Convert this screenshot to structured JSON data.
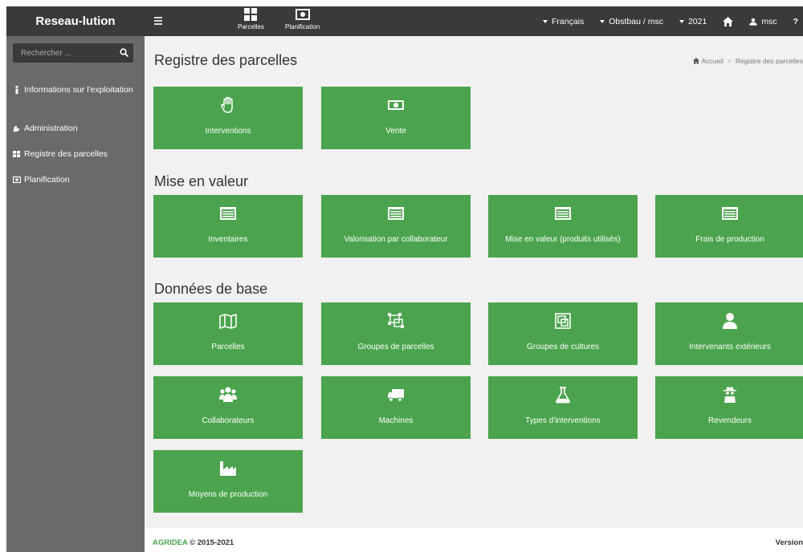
{
  "app": {
    "brand": "Reseau-lution"
  },
  "topnav": {
    "parcelles": "Parcelles",
    "planification": "Planification",
    "language": "Français",
    "account": "Obstbau / msc",
    "year": "2021",
    "user": "msc",
    "help": "?"
  },
  "sidebar": {
    "search_placeholder": "Rechercher ...",
    "items": [
      {
        "label": "Informations sur l'exploitation",
        "icon": "info-icon"
      },
      {
        "label": "Administration",
        "icon": "wrench-icon"
      },
      {
        "label": "Registre des parcelles",
        "icon": "grid-icon"
      },
      {
        "label": "Planification",
        "icon": "money-icon"
      }
    ]
  },
  "page": {
    "title": "Registre des parcelles",
    "breadcrumb": {
      "home": "Accueil",
      "separator": ">",
      "current": "Registre des parcelles"
    }
  },
  "sections": {
    "mise_en_valeur": "Mise en valeur",
    "donnees_de_base": "Données de base"
  },
  "tiles": {
    "interventions": "Interventions",
    "vente": "Vente",
    "inventaires": "Inventaires",
    "valorisation": "Valorisation par collaborateur",
    "mise_en_valeur_produits": "Mise en valeur (produits utilisés)",
    "frais": "Frais de production",
    "parcelles": "Parcelles",
    "groupes_parcelles": "Groupes de parcelles",
    "groupes_cultures": "Groupes de cultures",
    "intervenants": "Intervenants extérieurs",
    "collaborateurs": "Collaborateurs",
    "machines": "Machines",
    "types_interventions": "Types d'interventions",
    "revendeurs": "Revendeurs",
    "moyens": "Moyens de production"
  },
  "footer": {
    "brand": "AGRIDEA",
    "copyright": "© 2015-2021",
    "version": "Version"
  },
  "colors": {
    "tile": "#4ba44d",
    "topbar": "#3a3a3a",
    "sidebar": "#6a6a6a",
    "background": "#f1f1f1"
  }
}
